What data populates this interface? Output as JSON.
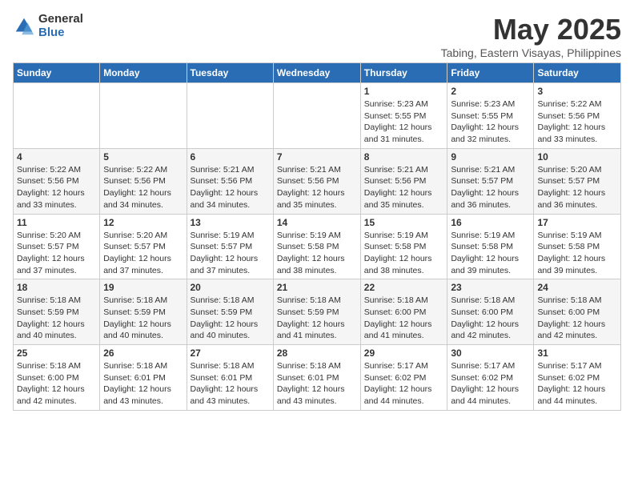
{
  "logo": {
    "general": "General",
    "blue": "Blue"
  },
  "title": "May 2025",
  "subtitle": "Tabing, Eastern Visayas, Philippines",
  "days_of_week": [
    "Sunday",
    "Monday",
    "Tuesday",
    "Wednesday",
    "Thursday",
    "Friday",
    "Saturday"
  ],
  "weeks": [
    [
      {
        "day": "",
        "info": ""
      },
      {
        "day": "",
        "info": ""
      },
      {
        "day": "",
        "info": ""
      },
      {
        "day": "",
        "info": ""
      },
      {
        "day": "1",
        "info": "Sunrise: 5:23 AM\nSunset: 5:55 PM\nDaylight: 12 hours and 31 minutes."
      },
      {
        "day": "2",
        "info": "Sunrise: 5:23 AM\nSunset: 5:55 PM\nDaylight: 12 hours and 32 minutes."
      },
      {
        "day": "3",
        "info": "Sunrise: 5:22 AM\nSunset: 5:56 PM\nDaylight: 12 hours and 33 minutes."
      }
    ],
    [
      {
        "day": "4",
        "info": "Sunrise: 5:22 AM\nSunset: 5:56 PM\nDaylight: 12 hours and 33 minutes."
      },
      {
        "day": "5",
        "info": "Sunrise: 5:22 AM\nSunset: 5:56 PM\nDaylight: 12 hours and 34 minutes."
      },
      {
        "day": "6",
        "info": "Sunrise: 5:21 AM\nSunset: 5:56 PM\nDaylight: 12 hours and 34 minutes."
      },
      {
        "day": "7",
        "info": "Sunrise: 5:21 AM\nSunset: 5:56 PM\nDaylight: 12 hours and 35 minutes."
      },
      {
        "day": "8",
        "info": "Sunrise: 5:21 AM\nSunset: 5:56 PM\nDaylight: 12 hours and 35 minutes."
      },
      {
        "day": "9",
        "info": "Sunrise: 5:21 AM\nSunset: 5:57 PM\nDaylight: 12 hours and 36 minutes."
      },
      {
        "day": "10",
        "info": "Sunrise: 5:20 AM\nSunset: 5:57 PM\nDaylight: 12 hours and 36 minutes."
      }
    ],
    [
      {
        "day": "11",
        "info": "Sunrise: 5:20 AM\nSunset: 5:57 PM\nDaylight: 12 hours and 37 minutes."
      },
      {
        "day": "12",
        "info": "Sunrise: 5:20 AM\nSunset: 5:57 PM\nDaylight: 12 hours and 37 minutes."
      },
      {
        "day": "13",
        "info": "Sunrise: 5:19 AM\nSunset: 5:57 PM\nDaylight: 12 hours and 37 minutes."
      },
      {
        "day": "14",
        "info": "Sunrise: 5:19 AM\nSunset: 5:58 PM\nDaylight: 12 hours and 38 minutes."
      },
      {
        "day": "15",
        "info": "Sunrise: 5:19 AM\nSunset: 5:58 PM\nDaylight: 12 hours and 38 minutes."
      },
      {
        "day": "16",
        "info": "Sunrise: 5:19 AM\nSunset: 5:58 PM\nDaylight: 12 hours and 39 minutes."
      },
      {
        "day": "17",
        "info": "Sunrise: 5:19 AM\nSunset: 5:58 PM\nDaylight: 12 hours and 39 minutes."
      }
    ],
    [
      {
        "day": "18",
        "info": "Sunrise: 5:18 AM\nSunset: 5:59 PM\nDaylight: 12 hours and 40 minutes."
      },
      {
        "day": "19",
        "info": "Sunrise: 5:18 AM\nSunset: 5:59 PM\nDaylight: 12 hours and 40 minutes."
      },
      {
        "day": "20",
        "info": "Sunrise: 5:18 AM\nSunset: 5:59 PM\nDaylight: 12 hours and 40 minutes."
      },
      {
        "day": "21",
        "info": "Sunrise: 5:18 AM\nSunset: 5:59 PM\nDaylight: 12 hours and 41 minutes."
      },
      {
        "day": "22",
        "info": "Sunrise: 5:18 AM\nSunset: 6:00 PM\nDaylight: 12 hours and 41 minutes."
      },
      {
        "day": "23",
        "info": "Sunrise: 5:18 AM\nSunset: 6:00 PM\nDaylight: 12 hours and 42 minutes."
      },
      {
        "day": "24",
        "info": "Sunrise: 5:18 AM\nSunset: 6:00 PM\nDaylight: 12 hours and 42 minutes."
      }
    ],
    [
      {
        "day": "25",
        "info": "Sunrise: 5:18 AM\nSunset: 6:00 PM\nDaylight: 12 hours and 42 minutes."
      },
      {
        "day": "26",
        "info": "Sunrise: 5:18 AM\nSunset: 6:01 PM\nDaylight: 12 hours and 43 minutes."
      },
      {
        "day": "27",
        "info": "Sunrise: 5:18 AM\nSunset: 6:01 PM\nDaylight: 12 hours and 43 minutes."
      },
      {
        "day": "28",
        "info": "Sunrise: 5:18 AM\nSunset: 6:01 PM\nDaylight: 12 hours and 43 minutes."
      },
      {
        "day": "29",
        "info": "Sunrise: 5:17 AM\nSunset: 6:02 PM\nDaylight: 12 hours and 44 minutes."
      },
      {
        "day": "30",
        "info": "Sunrise: 5:17 AM\nSunset: 6:02 PM\nDaylight: 12 hours and 44 minutes."
      },
      {
        "day": "31",
        "info": "Sunrise: 5:17 AM\nSunset: 6:02 PM\nDaylight: 12 hours and 44 minutes."
      }
    ]
  ]
}
